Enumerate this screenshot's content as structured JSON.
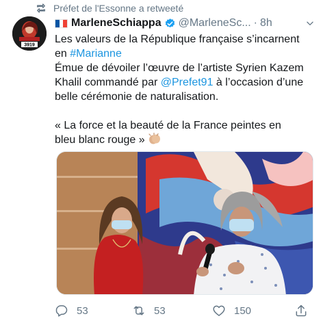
{
  "retweet_header": {
    "text": "Préfet de l'Essonne a retweeté",
    "icon": "retweet-icon"
  },
  "avatar": {
    "label": "3919"
  },
  "author": {
    "display_name": "MarleneSchiappa",
    "flag_colors": [
      "#0055a4",
      "#ffffff",
      "#ef4135"
    ],
    "handle": "@MarleneSc...",
    "separator": "·",
    "time": "8h",
    "verified_icon": "verified-badge-icon"
  },
  "tweet": {
    "line1": "Les valeurs de la République française s’incarnent",
    "line2_prefix": "en ",
    "hashtag": "#Marianne",
    "line3": "Émue de dévoiler l’œuvre de l’artiste Syrien Kazem",
    "line4_prefix": "Khalil commandé par ",
    "mention": "@Prefet91",
    "line4_suffix": " à l’occasion d’une",
    "line5": "belle cérémonie de naturalisation.",
    "line6": "« La force et la beauté de la France peintes en",
    "line7": "bleu blanc rouge »",
    "emoji": "clapping-hands-icon"
  },
  "actions": {
    "reply_count": "53",
    "retweet_count": "53",
    "like_count": "150"
  },
  "colors": {
    "link": "#1b95e0",
    "muted": "#657786",
    "verified": "#1da1f2"
  }
}
